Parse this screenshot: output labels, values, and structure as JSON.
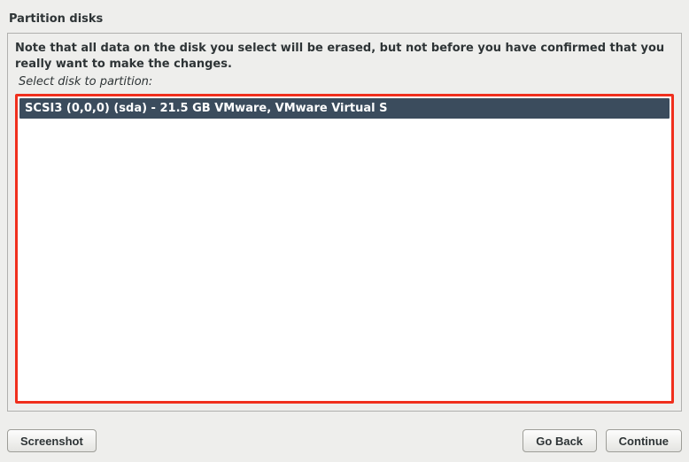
{
  "header": {
    "title": "Partition disks"
  },
  "main": {
    "note": "Note that all data on the disk you select will be erased, but not before you have confirmed that you really want to make the changes.",
    "prompt": "Select disk to partition:",
    "disks": [
      {
        "label": "SCSI3 (0,0,0) (sda) - 21.5 GB VMware, VMware Virtual S"
      }
    ]
  },
  "buttons": {
    "screenshot": "Screenshot",
    "go_back": "Go Back",
    "continue": "Continue"
  }
}
